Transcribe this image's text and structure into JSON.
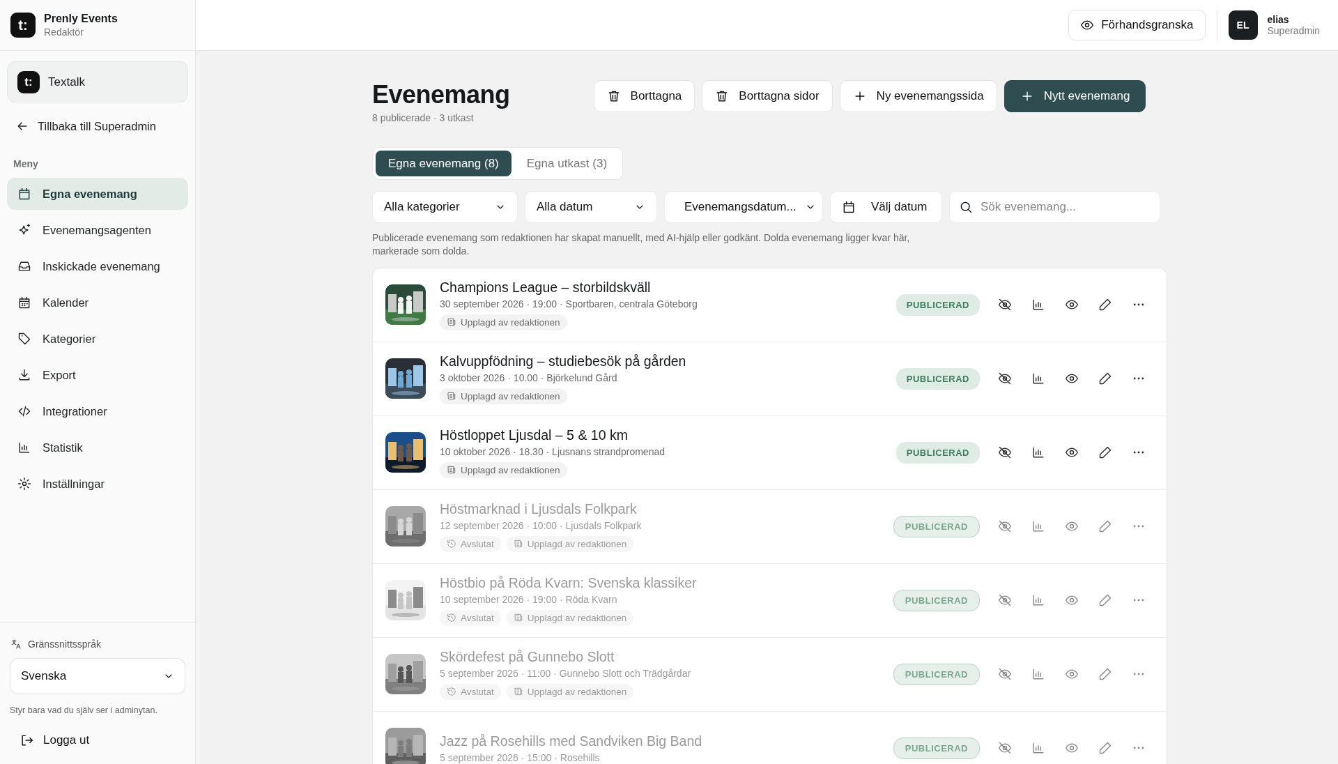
{
  "brand": {
    "logo": "t:",
    "name": "Prenly Events",
    "role": "Redaktör"
  },
  "workspace": {
    "logo": "t:",
    "name": "Textalk"
  },
  "back_link": "Tillbaka till Superadmin",
  "menu": {
    "heading": "Meny",
    "items": [
      {
        "label": "Egna evenemang",
        "kind": "calendar",
        "selected": true
      },
      {
        "label": "Evenemangsagenten",
        "kind": "sparkle",
        "selected": false
      },
      {
        "label": "Inskickade evenemang",
        "kind": "inbox",
        "selected": false
      },
      {
        "label": "Kalender",
        "kind": "calendar-grid",
        "selected": false
      },
      {
        "label": "Kategorier",
        "kind": "tag",
        "selected": false
      },
      {
        "label": "Export",
        "kind": "download",
        "selected": false
      },
      {
        "label": "Integrationer",
        "kind": "code",
        "selected": false
      },
      {
        "label": "Statistik",
        "kind": "chart",
        "selected": false
      },
      {
        "label": "Inställningar",
        "kind": "gear",
        "selected": false
      }
    ]
  },
  "language": {
    "label": "Gränssnittsspråk",
    "value": "Svenska",
    "hint": "Styr bara vad du själv ser i adminytan."
  },
  "logout": "Logga ut",
  "topbar": {
    "preview": "Förhandsgranska",
    "user": {
      "initials": "EL",
      "name": "elias",
      "role": "Superadmin"
    }
  },
  "page": {
    "title": "Evenemang",
    "subtitle": "8 publicerade · 3 utkast",
    "actions": [
      {
        "label": "Borttagna",
        "kind": "trash",
        "primary": false
      },
      {
        "label": "Borttagna sidor",
        "kind": "trash",
        "primary": false
      },
      {
        "label": "Ny evenemangssida",
        "kind": "plus",
        "primary": false
      },
      {
        "label": "Nytt evenemang",
        "kind": "plus",
        "primary": true
      }
    ]
  },
  "tabs": [
    {
      "label": "Egna evenemang (8)",
      "selected": true
    },
    {
      "label": "Egna utkast (3)",
      "selected": false
    }
  ],
  "filters": [
    {
      "kind": "select",
      "label": "Alla kategorier"
    },
    {
      "kind": "select",
      "label": "Alla datum"
    },
    {
      "kind": "select",
      "label": "Evenemangsdatum..."
    },
    {
      "kind": "date",
      "label": "Välj datum"
    },
    {
      "kind": "search",
      "placeholder": "Sök evenemang..."
    }
  ],
  "info": "Publicerade evenemang som redaktionen har skapat manuellt, med AI-hjälp eller godkänt. Dolda evenemang ligger kvar här, markerade som dolda.",
  "events": [
    {
      "title": "Champions League – storbildskväll",
      "meta": "30 september 2026 · 19:00 · Sportbaren, centrala Göteborg",
      "dimmed": false,
      "status": "PUBLICERAD",
      "tags": [
        {
          "kind": "editorial",
          "label": "Upplagd av redaktionen"
        }
      ]
    },
    {
      "title": "Kalvuppfödning – studiebesök på gården",
      "meta": "3 oktober 2026 · 10.00 · Björkelund Gård",
      "dimmed": false,
      "status": "PUBLICERAD",
      "tags": [
        {
          "kind": "editorial",
          "label": "Upplagd av redaktionen"
        }
      ]
    },
    {
      "title": "Höstloppet Ljusdal – 5 & 10 km",
      "meta": "10 oktober 2026 · 18.30 · Ljusnans strandpromenad",
      "dimmed": false,
      "status": "PUBLICERAD",
      "tags": [
        {
          "kind": "editorial",
          "label": "Upplagd av redaktionen"
        }
      ]
    },
    {
      "title": "Höstmarknad i Ljusdals Folkpark",
      "meta": "12 september 2026 · 10:00 · Ljusdals Folkpark",
      "dimmed": true,
      "status": "PUBLICERAD",
      "tags": [
        {
          "kind": "ended",
          "label": "Avslutat"
        },
        {
          "kind": "editorial",
          "label": "Upplagd av redaktionen"
        }
      ]
    },
    {
      "title": "Höstbio på Röda Kvarn: Svenska klassiker",
      "meta": "10 september 2026 · 19:00 · Röda Kvarn",
      "dimmed": true,
      "status": "PUBLICERAD",
      "tags": [
        {
          "kind": "ended",
          "label": "Avslutat"
        },
        {
          "kind": "editorial",
          "label": "Upplagd av redaktionen"
        }
      ]
    },
    {
      "title": "Skördefest på Gunnebo Slott",
      "meta": "5 september 2026 · 11:00 · Gunnebo Slott och Trädgårdar",
      "dimmed": true,
      "status": "PUBLICERAD",
      "tags": [
        {
          "kind": "ended",
          "label": "Avslutat"
        },
        {
          "kind": "editorial",
          "label": "Upplagd av redaktionen"
        }
      ]
    },
    {
      "title": "Jazz på Rosehills med Sandviken Big Band",
      "meta": "5 september 2026 · 15:00 · Rosehills",
      "dimmed": true,
      "status": "PUBLICERAD"
    }
  ]
}
